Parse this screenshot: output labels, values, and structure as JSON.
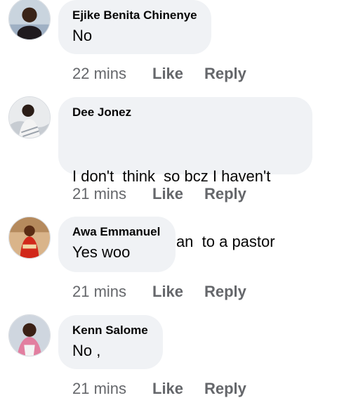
{
  "comments": [
    {
      "author": "Ejike Benita Chinenye",
      "text": "No",
      "time": "22 mins",
      "like": "Like",
      "reply": "Reply"
    },
    {
      "author": "Dee Jonez",
      "text_lines": [
        "I don't  think  so bcz I haven't",
        "seem any woman  to a pastor"
      ],
      "time": "21 mins",
      "like": "Like",
      "reply": "Reply"
    },
    {
      "author": "Awa Emmanuel",
      "text": "Yes woo",
      "time": "21 mins",
      "like": "Like",
      "reply": "Reply"
    },
    {
      "author": "Kenn Salome",
      "text": "No ,",
      "time": "21 mins",
      "like": "Like",
      "reply": "Reply"
    }
  ],
  "colors": {
    "bubble": "#f0f2f5",
    "text": "#050505",
    "meta": "#65676b"
  }
}
